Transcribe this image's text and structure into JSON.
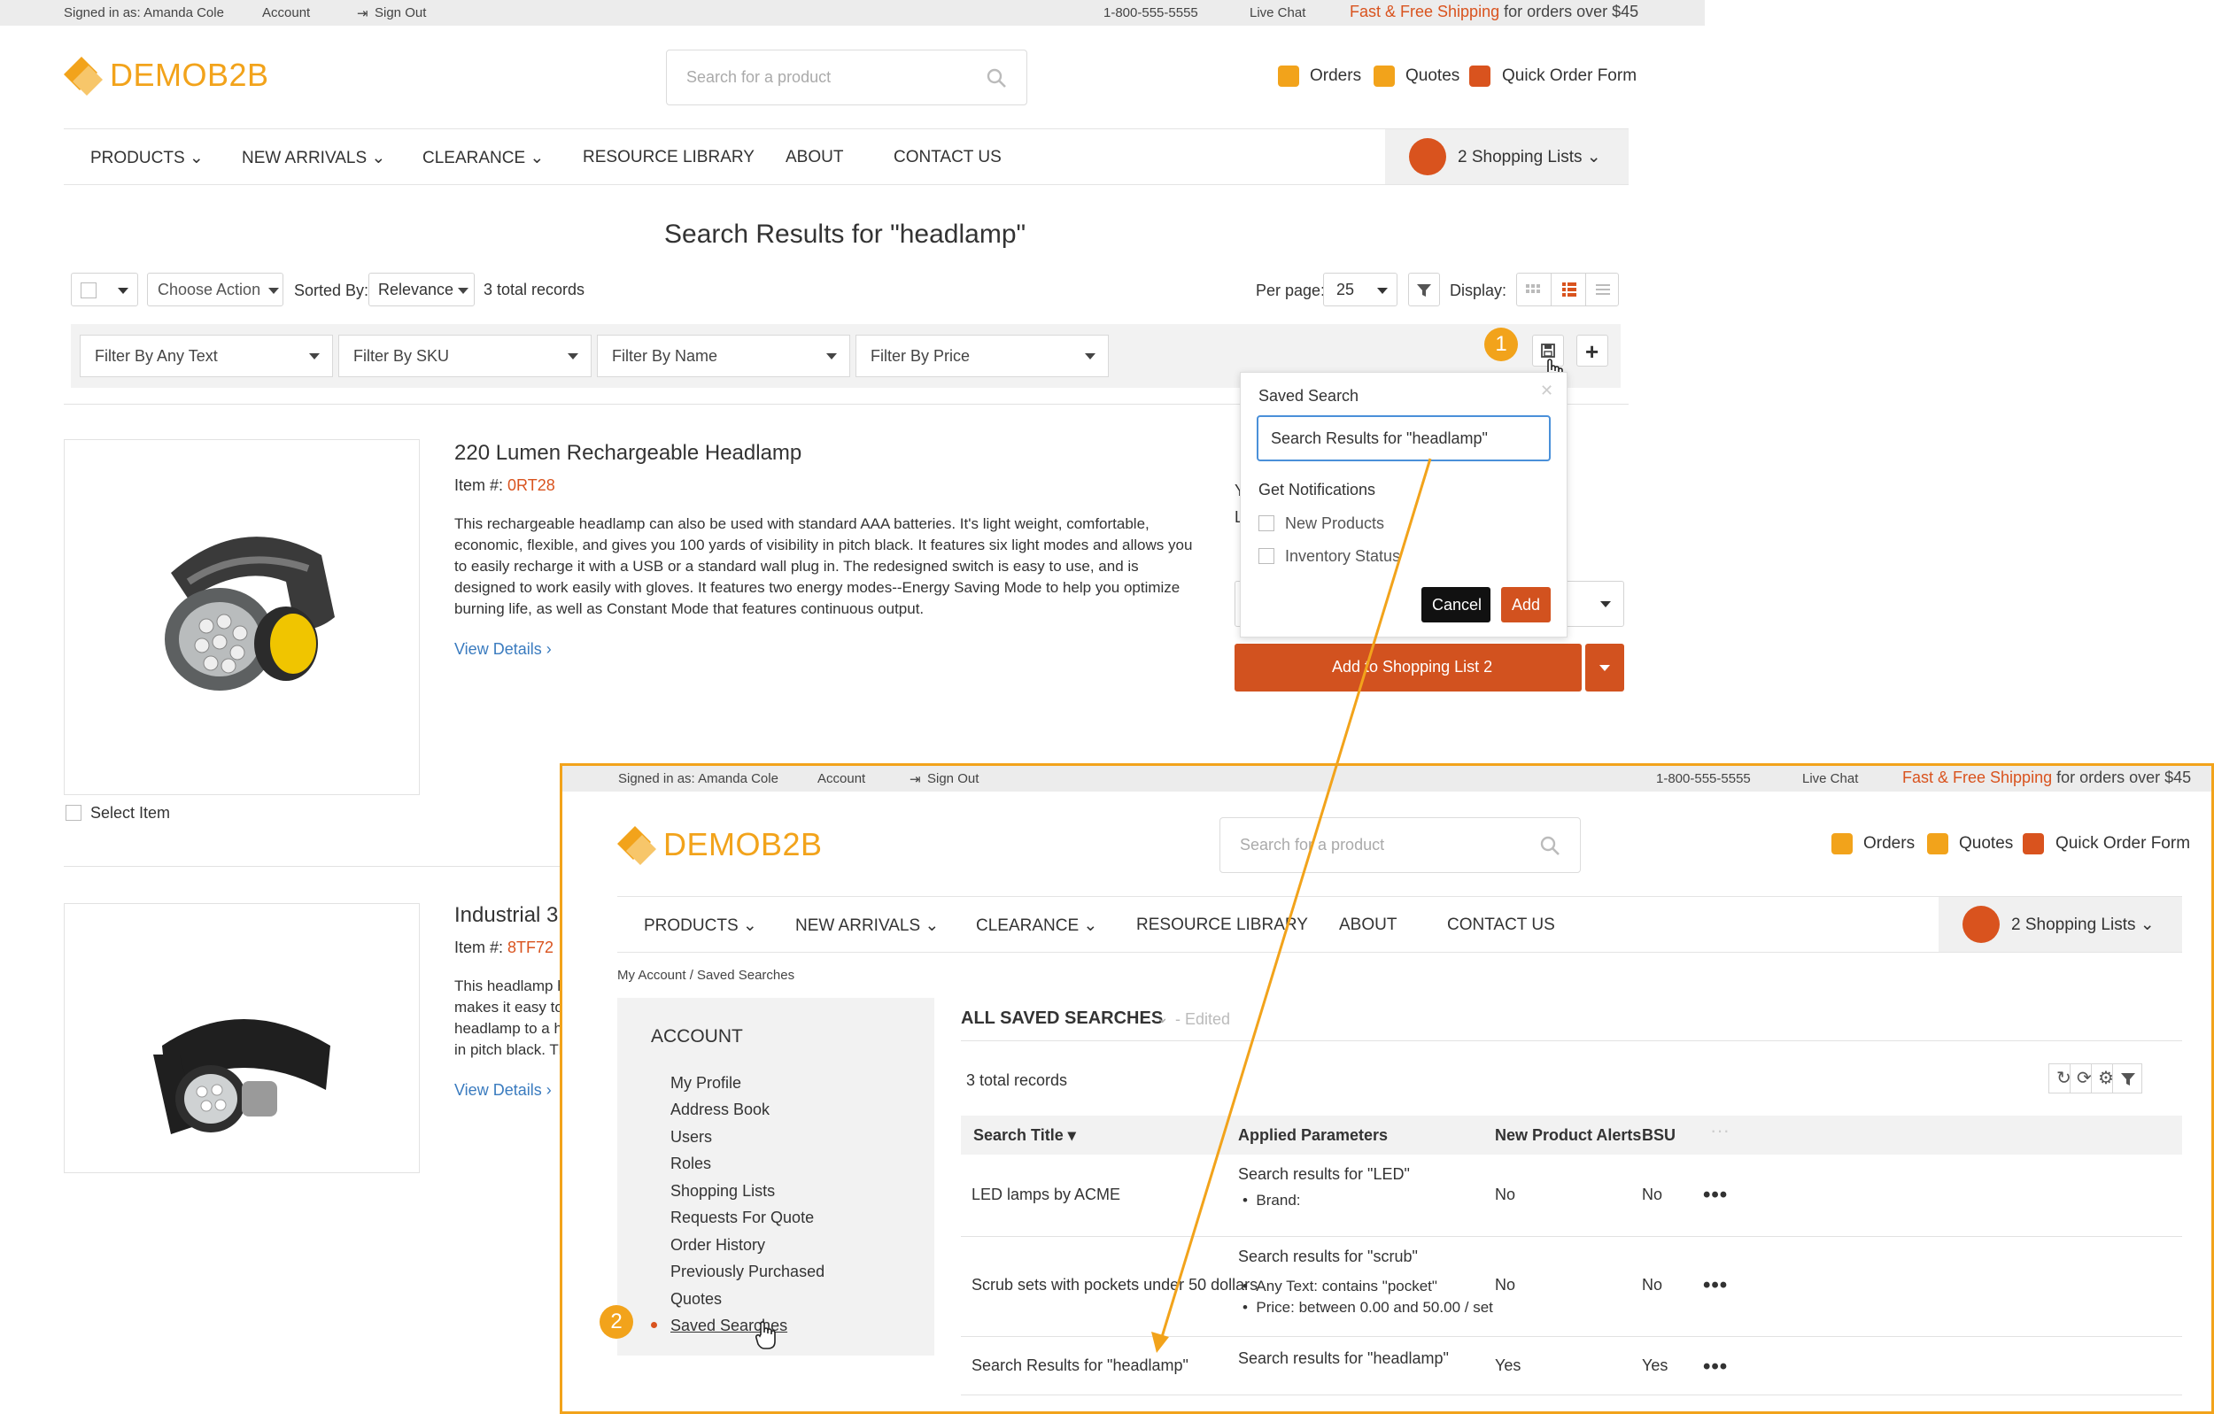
{
  "topbar": {
    "signed_in": "Signed in as: Amanda Cole",
    "account": "Account",
    "sign_out": "Sign Out",
    "phone": "1-800-555-5555",
    "live_chat": "Live Chat",
    "shipping_link": "Fast & Free Shipping",
    "shipping_rest": "for orders over $45"
  },
  "header": {
    "logo_a": "DEMO",
    "logo_b": "B2B",
    "search_placeholder": "Search for a product",
    "orders": "Orders",
    "quotes": "Quotes",
    "quick_order": "Quick Order Form"
  },
  "nav": {
    "items": [
      "PRODUCTS",
      "NEW ARRIVALS",
      "CLEARANCE",
      "RESOURCE LIBRARY",
      "ABOUT",
      "CONTACT US"
    ],
    "shopping_lists": "2 Shopping Lists"
  },
  "results": {
    "title": "Search Results for \"headlamp\"",
    "choose_action": "Choose Action",
    "sorted_by": "Sorted By:",
    "sort_value": "Relevance",
    "total": "3 total records",
    "per_page_label": "Per page:",
    "per_page_value": "25",
    "display_label": "Display:",
    "filters": [
      "Filter By Any Text",
      "Filter By SKU",
      "Filter By Name",
      "Filter By Price"
    ]
  },
  "products": [
    {
      "title": "220 Lumen Rechargeable Headlamp",
      "item_label": "Item #:",
      "sku": "0RT28",
      "desc": "This rechargeable headlamp can also be used with standard AAA batteries. It's light weight, comfortable, economic, flexible, and gives you 100 yards of visibility in pitch black. It features six light modes and allows you to easily recharge it with a USB or a standard wall plug in. The redesigned switch is easy to use, and is designed to work easily with gloves. It features two energy modes--Energy Saving Mode to help you optimize burning life, as well as Constant Mode that features continuous output.",
      "view_details": "View Details ›",
      "select_item": "Select Item"
    },
    {
      "title": "Industrial 3",
      "item_label": "Item #:",
      "sku": "8TF72",
      "desc_lines": [
        "This headlamp h",
        "makes it easy to",
        "headlamp to a h",
        "in pitch black. Th"
      ],
      "view_details": "View Details ›"
    }
  ],
  "side_letters": [
    "Y",
    "L"
  ],
  "add_to_list": "Add to Shopping List 2",
  "popup": {
    "title": "Saved Search",
    "input_value": "Search Results for \"headlamp\"",
    "notifications": "Get Notifications",
    "opt1": "New Products",
    "opt2": "Inventory Status",
    "cancel": "Cancel",
    "add": "Add"
  },
  "badges": [
    "1",
    "2"
  ],
  "inset": {
    "breadcrumb": "My Account / Saved Searches",
    "side_title": "ACCOUNT",
    "side_items": [
      "My Profile",
      "Address Book",
      "Users",
      "Roles",
      "Shopping Lists",
      "Requests For Quote",
      "Order History",
      "Previously Purchased",
      "Quotes",
      "Saved Searches"
    ],
    "heading": "ALL SAVED SEARCHES",
    "edited": "- Edited",
    "total": "3 total records",
    "columns": [
      "Search Title",
      "Applied Parameters",
      "New Product Alerts",
      "BSU"
    ],
    "rows": [
      {
        "title": "LED lamps by ACME",
        "params": "Search results for \"LED\"",
        "bullets": [
          "Brand:"
        ],
        "alerts": "No",
        "bsu": "No"
      },
      {
        "title": "Scrub sets with pockets under 50 dollars",
        "params": "Search results for \"scrub\"",
        "bullets": [
          "Any Text: contains \"pocket\"",
          "Price: between 0.00 and 50.00 / set"
        ],
        "alerts": "No",
        "bsu": "No"
      },
      {
        "title": "Search Results for \"headlamp\"",
        "params": "Search results for \"headlamp\"",
        "bullets": [],
        "alerts": "Yes",
        "bsu": "Yes"
      }
    ]
  },
  "colors": {
    "accent": "#d9531e",
    "brand": "#f2a31b",
    "link": "#3a7bbf"
  }
}
